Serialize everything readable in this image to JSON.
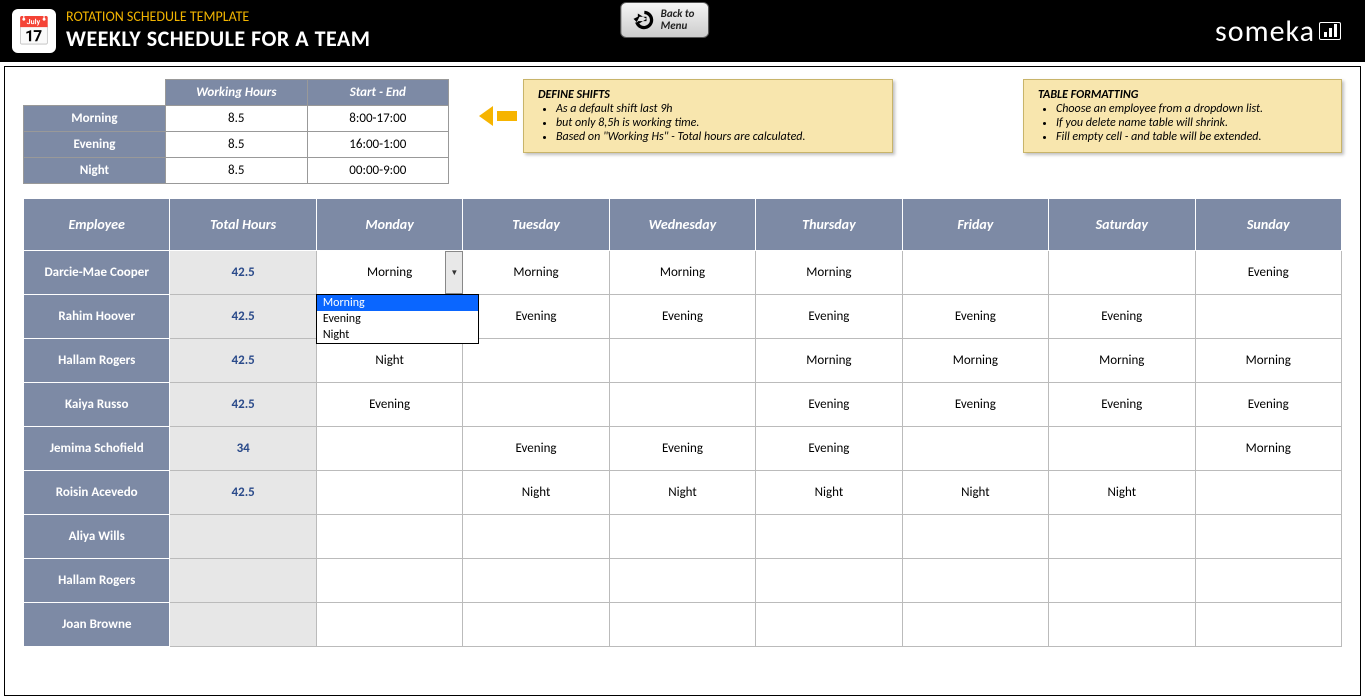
{
  "header": {
    "template_name": "ROTATION SCHEDULE TEMPLATE",
    "page_title": "WEEKLY SCHEDULE FOR A TEAM",
    "back_button": "Back to\nMenu",
    "brand": "someka"
  },
  "shift_defs": {
    "cols": [
      "Working Hours",
      "Start - End"
    ],
    "rows": [
      {
        "label": "Morning",
        "hours": "8.5",
        "range": "8:00-17:00"
      },
      {
        "label": "Evening",
        "hours": "8.5",
        "range": "16:00-1:00"
      },
      {
        "label": "Night",
        "hours": "8.5",
        "range": "00:00-9:00"
      }
    ]
  },
  "notes": {
    "define": {
      "title": "DEFINE SHIFTS",
      "items": [
        "As a default shift last 9h",
        "but only 8,5h is working time.",
        "Based on \"Working Hs\" - Total hours are calculated."
      ]
    },
    "format": {
      "title": "TABLE FORMATTING",
      "items": [
        "Choose an employee from a dropdown list.",
        "If you delete name table will shrink.",
        "Fill empty cell - and table will be extended."
      ]
    }
  },
  "schedule": {
    "columns": [
      "Employee",
      "Total Hours",
      "Monday",
      "Tuesday",
      "Wednesday",
      "Thursday",
      "Friday",
      "Saturday",
      "Sunday"
    ],
    "dropdown": {
      "options": [
        "Morning",
        "Evening",
        "Night"
      ],
      "selected": "Morning"
    },
    "rows": [
      {
        "emp": "Darcie-Mae Cooper",
        "tot": "42.5",
        "d": [
          "Morning",
          "Morning",
          "Morning",
          "Morning",
          "",
          "",
          "Evening"
        ]
      },
      {
        "emp": "Rahim Hoover",
        "tot": "42.5",
        "d": [
          "",
          "Evening",
          "Evening",
          "Evening",
          "Evening",
          "Evening",
          ""
        ]
      },
      {
        "emp": "Hallam Rogers",
        "tot": "42.5",
        "d": [
          "Night",
          "",
          "",
          "Morning",
          "Morning",
          "Morning",
          "Morning"
        ]
      },
      {
        "emp": "Kaiya Russo",
        "tot": "42.5",
        "d": [
          "Evening",
          "",
          "",
          "Evening",
          "Evening",
          "Evening",
          "Evening"
        ]
      },
      {
        "emp": "Jemima Schofield",
        "tot": "34",
        "d": [
          "",
          "Evening",
          "Evening",
          "Evening",
          "",
          "",
          "Morning"
        ]
      },
      {
        "emp": "Roisin Acevedo",
        "tot": "42.5",
        "d": [
          "",
          "Night",
          "Night",
          "Night",
          "Night",
          "Night",
          ""
        ]
      },
      {
        "emp": "Aliya Wills",
        "tot": "",
        "d": [
          "",
          "",
          "",
          "",
          "",
          "",
          ""
        ]
      },
      {
        "emp": "Hallam Rogers",
        "tot": "",
        "d": [
          "",
          "",
          "",
          "",
          "",
          "",
          ""
        ]
      },
      {
        "emp": "Joan Browne",
        "tot": "",
        "d": [
          "",
          "",
          "",
          "",
          "",
          "",
          ""
        ]
      }
    ]
  }
}
